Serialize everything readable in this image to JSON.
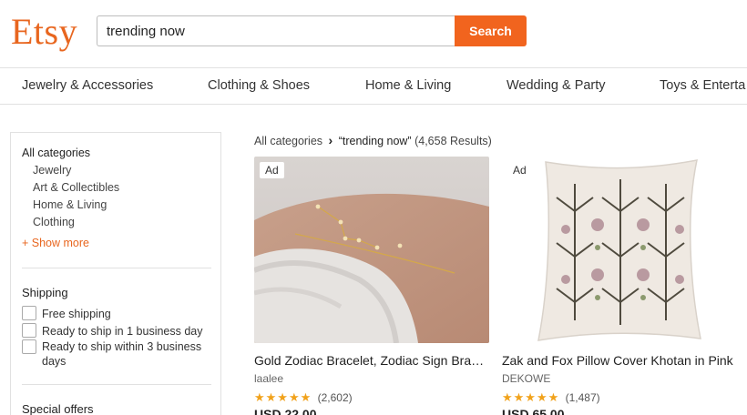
{
  "header": {
    "logo": "Etsy",
    "search_value": "trending now",
    "search_button": "Search"
  },
  "nav": {
    "items": [
      "Jewelry & Accessories",
      "Clothing & Shoes",
      "Home & Living",
      "Wedding & Party",
      "Toys & Enterta"
    ]
  },
  "sidebar": {
    "categories_heading": "All categories",
    "categories": [
      "Jewelry",
      "Art & Collectibles",
      "Home & Living",
      "Clothing"
    ],
    "show_more": "+ Show more",
    "shipping_heading": "Shipping",
    "shipping_options": [
      "Free shipping",
      "Ready to ship in 1 business day",
      "Ready to ship within 3 business days"
    ],
    "special_offers_heading": "Special offers"
  },
  "breadcrumb": {
    "root": "All categories",
    "query": "“trending now”",
    "count": "(4,658 Results)"
  },
  "listings": [
    {
      "ad": "Ad",
      "title": "Gold Zodiac Bracelet, Zodiac Sign Bracelet",
      "shop": "laalee",
      "stars": "★★★★★",
      "reviews": "(2,602)",
      "price": "USD 22.00"
    },
    {
      "ad": "Ad",
      "title": "Zak and Fox Pillow Cover Khotan in Pink",
      "shop": "DEKOWE",
      "stars": "★★★★★",
      "reviews": "(1,487)",
      "price": "USD 65.00"
    }
  ],
  "colors": {
    "brand": "#e8661f",
    "search_button": "#f1641e",
    "star": "#f1a21b"
  }
}
